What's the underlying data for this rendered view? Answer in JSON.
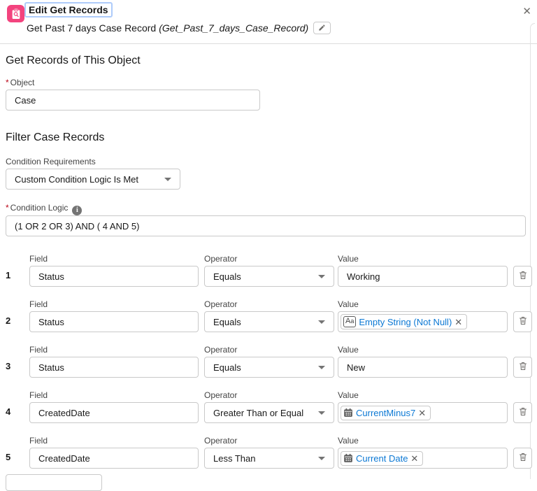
{
  "header": {
    "title": "Edit Get Records",
    "subtitle_main": "Get Past 7 days Case Record",
    "subtitle_api": "(Get_Past_7_days_Case_Record)",
    "close_glyph": "✕"
  },
  "object_section": {
    "heading": "Get Records of This Object",
    "required_marker": "*",
    "object_label": "Object",
    "object_value": "Case"
  },
  "filter_section": {
    "heading": "Filter Case Records",
    "condition_requirements_label": "Condition Requirements",
    "condition_requirements_value": "Custom Condition Logic Is Met",
    "required_marker": "*",
    "condition_logic_label": "Condition Logic",
    "condition_logic_value": "(1 OR 2 OR 3) AND ( 4 AND 5)"
  },
  "conditions": {
    "field_label": "Field",
    "operator_label": "Operator",
    "value_label": "Value",
    "rows": [
      {
        "index": "1",
        "field": "Status",
        "operator": "Equals",
        "value_type": "text",
        "value": "Working"
      },
      {
        "index": "2",
        "field": "Status",
        "operator": "Equals",
        "value_type": "pill-text",
        "value": "Empty String (Not Null)"
      },
      {
        "index": "3",
        "field": "Status",
        "operator": "Equals",
        "value_type": "text",
        "value": "New"
      },
      {
        "index": "4",
        "field": "CreatedDate",
        "operator": "Greater Than or Equal",
        "value_type": "pill-date",
        "value": "CurrentMinus7"
      },
      {
        "index": "5",
        "field": "CreatedDate",
        "operator": "Less Than",
        "value_type": "pill-date",
        "value": "Current Date"
      }
    ]
  },
  "colors": {
    "accent_pink": "#f3437e",
    "link_blue": "#0b78d4",
    "required_red": "#ba0517",
    "border_gray": "#c9c9c9",
    "label_gray": "#444444"
  }
}
